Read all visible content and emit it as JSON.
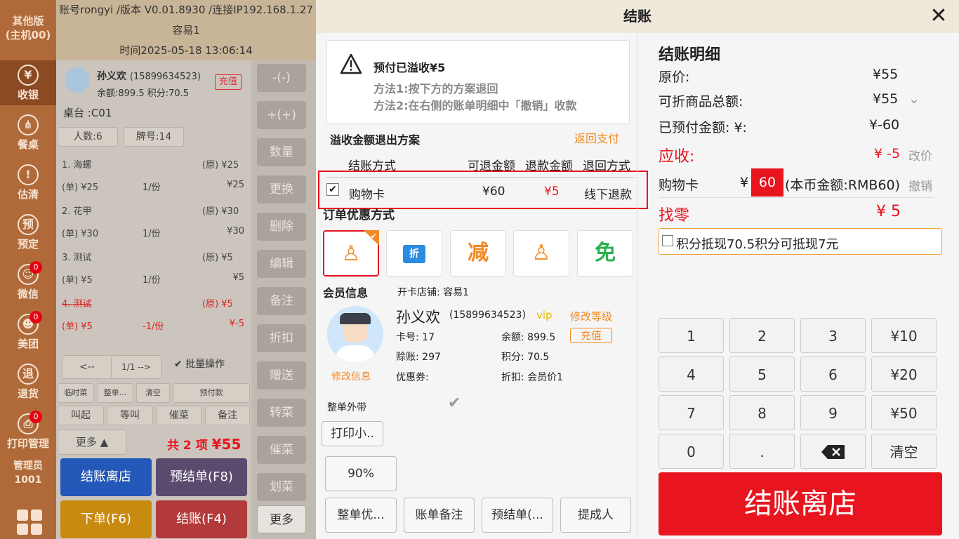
{
  "sidebar": {
    "version": [
      "其他版",
      "(主机00)"
    ],
    "items": [
      {
        "label": "收银",
        "icon": "¥",
        "active": true
      },
      {
        "label": "餐桌",
        "icon": "⋔"
      },
      {
        "label": "估清",
        "icon": "!"
      },
      {
        "label": "预定",
        "icon": "预"
      },
      {
        "label": "微信",
        "icon": "☺",
        "badge": "0"
      },
      {
        "label": "美团",
        "icon": "☻",
        "badge": "0"
      },
      {
        "label": "退货",
        "icon": "退"
      },
      {
        "label": "打印管理",
        "icon": "⎙",
        "badge": "0"
      }
    ],
    "admin_label": "管理员",
    "admin_id": "1001"
  },
  "header": {
    "account": "账号rongyi /版本 V0.01.8930 /连接IP192.168.1.27",
    "store": "容易1",
    "time": "时间2025-05-18 13:06:14"
  },
  "order": {
    "member_name": "孙义欢",
    "member_phone": "(15899634523)",
    "recharge": "充值",
    "balance": "余额:899.5",
    "points": "积分:70.5",
    "table": "桌台 :C01",
    "people": "人数:6",
    "card": "牌号:14",
    "items": [
      {
        "name": "1. 海螺",
        "orig": "(原) ¥25",
        "unit": "(单) ¥25",
        "qty": "1/份",
        "total": "¥25"
      },
      {
        "name": "2. 花甲",
        "orig": "(原) ¥30",
        "unit": "(单) ¥30",
        "qty": "1/份",
        "total": "¥30"
      },
      {
        "name": "3. 测试",
        "orig": "(原) ¥5",
        "unit": "(单) ¥5",
        "qty": "1/份",
        "total": "¥5"
      },
      {
        "name": "4. 测试",
        "orig": "(原) ¥5",
        "unit": "(单) ¥5",
        "qty": "-1/份",
        "total": "¥-5",
        "returned": true
      }
    ],
    "prev": "<--",
    "page": "1/1",
    "next": "-->",
    "batch": "批量操作",
    "small_btns": [
      "临时菜",
      "整单...",
      "清空",
      "预付款"
    ],
    "action_btns": [
      "叫起",
      "等叫",
      "催菜",
      "备注"
    ],
    "more": "更多",
    "summary_pre": "共",
    "summary_count": "2",
    "summary_mid": "项",
    "summary_total": "¥55",
    "bottom_btns": [
      "结账离店",
      "预结单(F8)",
      "下单(F6)",
      "结账(F4)"
    ]
  },
  "midcol": [
    "-(-)",
    "+(+)",
    "数量",
    "更换",
    "删除",
    "编辑",
    "备注",
    "折扣",
    "赠送",
    "转菜",
    "催菜",
    "划菜",
    "更多"
  ],
  "dialog": {
    "title": "结账",
    "notice_title": "预付已溢收¥5",
    "notice_line1": "方法1:按下方的方案退回",
    "notice_line2": "方法2:在右侧的账单明细中「撤销」收款",
    "overflow_title": "溢收金额退出方案",
    "return_pay": "返回支付",
    "refund_headers": [
      "结账方式",
      "可退金额",
      "退款金额",
      "退回方式"
    ],
    "refund_row": {
      "method": "购物卡",
      "available": "¥60",
      "refund": "¥5",
      "way": "线下退款"
    },
    "promo_title": "订单优惠方式",
    "promos": [
      {
        "icon": "member-discount-icon",
        "glyph": "♙",
        "color": "#f08a24"
      },
      {
        "icon": "discount-card-icon",
        "glyph": "折",
        "color": "#2a8ce0"
      },
      {
        "icon": "reduce-icon",
        "glyph": "减",
        "color": "#f08a24"
      },
      {
        "icon": "member-price-icon",
        "glyph": "♙",
        "color": "#f08a24"
      },
      {
        "icon": "free-icon",
        "glyph": "免",
        "color": "#2bb24c"
      }
    ],
    "member_title": "会员信息",
    "open_store": "开卡店铺:  容易1",
    "member_name": "孙义欢",
    "member_phone": "(15899634523)",
    "vip": "vip",
    "modify_level": "修改等级",
    "card_no": "卡号:  17",
    "balance": "余额:  899.5",
    "recharge": "充值",
    "credit": "赊账:  297",
    "points": "积分:  70.5",
    "coupon": "优惠券:",
    "discount": "折扣:  会员价1",
    "modify_info": "修改信息",
    "takeaway": "整单外带",
    "print_btn": "打印小..",
    "percent_btn": "90%",
    "bottom_btns": [
      "整单优...",
      "账单备注",
      "预结单(...",
      "提成人"
    ],
    "detail_title": "结账明细",
    "orig_label": "原价:",
    "orig_value": "¥55",
    "discountable_label": "可折商品总额:",
    "discountable_value": "¥55",
    "prepaid_label": "已预付金额:  ¥:",
    "prepaid_value": "¥-60",
    "due_label": "应收:",
    "due_value": "¥ -5",
    "due_action": "改价",
    "card_label": "购物卡",
    "card_currency": "¥",
    "card_amount": "60",
    "card_note": "(本币金额:RMB60)",
    "card_action": "撤销",
    "change_label": "找零",
    "change_value": "¥ 5",
    "points_offset": "积分抵现70.5积分可抵现7元",
    "keypad": [
      "1",
      "2",
      "3",
      "¥10",
      "4",
      "5",
      "6",
      "¥20",
      "7",
      "8",
      "9",
      "¥50",
      "0",
      ".",
      "⌫",
      "清空"
    ],
    "checkout": "结账离店"
  },
  "colors": {
    "accent_red": "#e8141e",
    "brand_orange": "#f08a24",
    "nav_brown": "#b06a3a"
  }
}
